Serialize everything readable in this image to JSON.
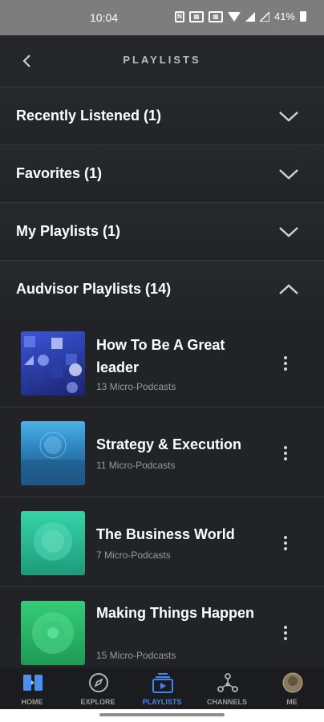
{
  "status_bar": {
    "time": "10:04",
    "battery": "41%",
    "icons": [
      "nfc-icon",
      "image-icon",
      "image-icon",
      "wifi-icon",
      "signal-icon",
      "signal-empty-icon",
      "battery-icon"
    ]
  },
  "header": {
    "title": "PLAYLISTS",
    "back_icon": "chevron-left-icon"
  },
  "sections": [
    {
      "label": "Recently Listened (1)",
      "expanded": false
    },
    {
      "label": "Favorites (1)",
      "expanded": false
    },
    {
      "label": "My Playlists (1)",
      "expanded": false
    },
    {
      "label": "Audvisor Playlists (14)",
      "expanded": true
    }
  ],
  "playlists": [
    {
      "title": "How To Be A Great leader",
      "subtitle": "13 Micro-Podcasts",
      "color": "#2a3aa8"
    },
    {
      "title": "Strategy & Execution",
      "subtitle": "11 Micro-Podcasts",
      "color": "#2f86c2"
    },
    {
      "title": "The Business World",
      "subtitle": "7 Micro-Podcasts",
      "color": "#2dbf9a"
    },
    {
      "title": "Making Things Happen",
      "subtitle": "15 Micro-Podcasts",
      "color": "#2cb86a"
    }
  ],
  "tabs": [
    {
      "label": "HOME",
      "icon": "home-icon"
    },
    {
      "label": "EXPLORE",
      "icon": "compass-icon"
    },
    {
      "label": "PLAYLISTS",
      "icon": "playlist-icon",
      "active": true
    },
    {
      "label": "CHANNELS",
      "icon": "channels-icon"
    },
    {
      "label": "ME",
      "icon": "avatar-icon"
    }
  ],
  "colors": {
    "accent": "#3f86f0",
    "background": "#222326",
    "tabbar": "#1b1c1f"
  }
}
